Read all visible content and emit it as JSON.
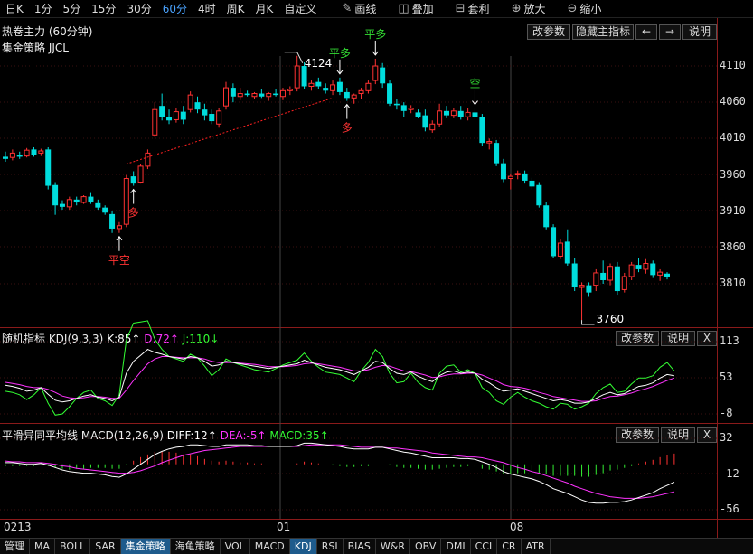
{
  "toolbar": {
    "periods": [
      "日K",
      "1分",
      "5分",
      "15分",
      "30分",
      "60分",
      "4时",
      "周K",
      "月K",
      "自定义"
    ],
    "active_period": "60分",
    "tools": [
      {
        "label": "画线",
        "icon": "pencil-icon"
      },
      {
        "label": "叠加",
        "icon": "stack-icon"
      },
      {
        "label": "套利",
        "icon": "arbitrage-icon"
      },
      {
        "label": "放大",
        "icon": "zoom-in-icon"
      },
      {
        "label": "缩小",
        "icon": "zoom-out-icon"
      }
    ]
  },
  "main": {
    "title": "热卷主力 (60分钟)",
    "strategy": "集金策略 JJCL",
    "buttons": {
      "params": "改参数",
      "hide": "隐藏主指标",
      "prev": "←",
      "next": "→",
      "help": "说明"
    },
    "y_ticks": [
      "4110",
      "4060",
      "4010",
      "3960",
      "3910",
      "3860",
      "3810"
    ],
    "high_label": "4124",
    "low_label": "3760",
    "signals": [
      {
        "text": "平空",
        "color": "#ff3333"
      },
      {
        "text": "多",
        "color": "#ff3333"
      },
      {
        "text": "平多",
        "color": "#33dd33"
      },
      {
        "text": "多",
        "color": "#ff3333"
      },
      {
        "text": "平多",
        "color": "#33dd33"
      },
      {
        "text": "空",
        "color": "#33dd33"
      }
    ]
  },
  "kdj": {
    "title": "随机指标 KDJ(9,3,3)",
    "k_label": "K:85↑",
    "d_label": "D:72↑",
    "j_label": "J:110↓",
    "colors": {
      "k": "#ffffff",
      "d": "#ff33ff",
      "j": "#33ff33"
    },
    "buttons": {
      "params": "改参数",
      "help": "说明",
      "close": "X"
    },
    "y_ticks": [
      "113",
      "53",
      "-8"
    ]
  },
  "macd": {
    "title": "平滑异同平均线 MACD(12,26,9)",
    "diff_label": "DIFF:12↑",
    "dea_label": "DEA:-5↑",
    "macd_label": "MACD:35↑",
    "buttons": {
      "params": "改参数",
      "help": "说明",
      "close": "X"
    },
    "y_ticks": [
      "32",
      "-12",
      "-56"
    ]
  },
  "x_axis": {
    "labels": [
      "0213",
      "01",
      "08"
    ]
  },
  "bottom_tabs": [
    "管理",
    "MA",
    "BOLL",
    "SAR",
    "集金策略",
    "海龟策略",
    "VOL",
    "MACD",
    "KDJ",
    "RSI",
    "BIAS",
    "W&R",
    "OBV",
    "DMI",
    "CCI",
    "CR",
    "ATR"
  ],
  "active_tabs": [
    "集金策略",
    "KDJ"
  ],
  "chart_data": {
    "type": "candlestick",
    "ylim": [
      3760,
      4124
    ],
    "candles": [
      {
        "o": 3985,
        "h": 3992,
        "l": 3978,
        "c": 3982
      },
      {
        "o": 3984,
        "h": 3995,
        "l": 3980,
        "c": 3990
      },
      {
        "o": 3988,
        "h": 3992,
        "l": 3982,
        "c": 3985
      },
      {
        "o": 3986,
        "h": 3997,
        "l": 3984,
        "c": 3994
      },
      {
        "o": 3995,
        "h": 3998,
        "l": 3985,
        "c": 3988
      },
      {
        "o": 3990,
        "h": 3996,
        "l": 3986,
        "c": 3993
      },
      {
        "o": 3995,
        "h": 3998,
        "l": 3940,
        "c": 3945
      },
      {
        "o": 3946,
        "h": 3950,
        "l": 3905,
        "c": 3918
      },
      {
        "o": 3920,
        "h": 3925,
        "l": 3912,
        "c": 3916
      },
      {
        "o": 3916,
        "h": 3930,
        "l": 3912,
        "c": 3926
      },
      {
        "o": 3926,
        "h": 3930,
        "l": 3918,
        "c": 3922
      },
      {
        "o": 3922,
        "h": 3932,
        "l": 3920,
        "c": 3930
      },
      {
        "o": 3930,
        "h": 3935,
        "l": 3920,
        "c": 3922
      },
      {
        "o": 3921,
        "h": 3926,
        "l": 3912,
        "c": 3915
      },
      {
        "o": 3915,
        "h": 3918,
        "l": 3905,
        "c": 3908
      },
      {
        "o": 3906,
        "h": 3910,
        "l": 3880,
        "c": 3886
      },
      {
        "o": 3886,
        "h": 3895,
        "l": 3880,
        "c": 3890
      },
      {
        "o": 3892,
        "h": 3960,
        "l": 3888,
        "c": 3955
      },
      {
        "o": 3958,
        "h": 3965,
        "l": 3945,
        "c": 3948
      },
      {
        "o": 3950,
        "h": 3975,
        "l": 3948,
        "c": 3972
      },
      {
        "o": 3972,
        "h": 3995,
        "l": 3968,
        "c": 3990
      },
      {
        "o": 4015,
        "h": 4060,
        "l": 4012,
        "c": 4050
      },
      {
        "o": 4055,
        "h": 4072,
        "l": 4035,
        "c": 4040
      },
      {
        "o": 4040,
        "h": 4050,
        "l": 4030,
        "c": 4035
      },
      {
        "o": 4036,
        "h": 4052,
        "l": 4032,
        "c": 4047
      },
      {
        "o": 4047,
        "h": 4055,
        "l": 4030,
        "c": 4036
      },
      {
        "o": 4050,
        "h": 4075,
        "l": 4046,
        "c": 4070
      },
      {
        "o": 4060,
        "h": 4068,
        "l": 4045,
        "c": 4050
      },
      {
        "o": 4050,
        "h": 4058,
        "l": 4035,
        "c": 4042
      },
      {
        "o": 4044,
        "h": 4050,
        "l": 4030,
        "c": 4034
      },
      {
        "o": 4030,
        "h": 4052,
        "l": 4025,
        "c": 4048
      },
      {
        "o": 4055,
        "h": 4088,
        "l": 4050,
        "c": 4080
      },
      {
        "o": 4080,
        "h": 4086,
        "l": 4060,
        "c": 4068
      },
      {
        "o": 4068,
        "h": 4080,
        "l": 4063,
        "c": 4072
      },
      {
        "o": 4072,
        "h": 4076,
        "l": 4068,
        "c": 4070
      },
      {
        "o": 4068,
        "h": 4074,
        "l": 4064,
        "c": 4072
      },
      {
        "o": 4072,
        "h": 4078,
        "l": 4066,
        "c": 4068
      },
      {
        "o": 4068,
        "h": 4074,
        "l": 4062,
        "c": 4072
      },
      {
        "o": 4072,
        "h": 4078,
        "l": 4068,
        "c": 4070
      },
      {
        "o": 4068,
        "h": 4080,
        "l": 4063,
        "c": 4076
      },
      {
        "o": 4076,
        "h": 4082,
        "l": 4070,
        "c": 4078
      },
      {
        "o": 4080,
        "h": 4124,
        "l": 4075,
        "c": 4110
      },
      {
        "o": 4110,
        "h": 4115,
        "l": 4078,
        "c": 4082
      },
      {
        "o": 4082,
        "h": 4090,
        "l": 4076,
        "c": 4086
      },
      {
        "o": 4088,
        "h": 4094,
        "l": 4078,
        "c": 4082
      },
      {
        "o": 4080,
        "h": 4086,
        "l": 4072,
        "c": 4076
      },
      {
        "o": 4076,
        "h": 4090,
        "l": 4070,
        "c": 4084
      },
      {
        "o": 4088,
        "h": 4094,
        "l": 4070,
        "c": 4074
      },
      {
        "o": 4074,
        "h": 4080,
        "l": 4062,
        "c": 4066
      },
      {
        "o": 4066,
        "h": 4072,
        "l": 4058,
        "c": 4070
      },
      {
        "o": 4072,
        "h": 4080,
        "l": 4065,
        "c": 4076
      },
      {
        "o": 4076,
        "h": 4090,
        "l": 4072,
        "c": 4086
      },
      {
        "o": 4090,
        "h": 4120,
        "l": 4085,
        "c": 4110
      },
      {
        "o": 4108,
        "h": 4114,
        "l": 4080,
        "c": 4086
      },
      {
        "o": 4086,
        "h": 4090,
        "l": 4055,
        "c": 4058
      },
      {
        "o": 4058,
        "h": 4064,
        "l": 4050,
        "c": 4056
      },
      {
        "o": 4056,
        "h": 4060,
        "l": 4040,
        "c": 4048
      },
      {
        "o": 4050,
        "h": 4056,
        "l": 4045,
        "c": 4052
      },
      {
        "o": 4046,
        "h": 4050,
        "l": 4038,
        "c": 4040
      },
      {
        "o": 4042,
        "h": 4050,
        "l": 4020,
        "c": 4025
      },
      {
        "o": 4022,
        "h": 4035,
        "l": 4018,
        "c": 4030
      },
      {
        "o": 4030,
        "h": 4058,
        "l": 4026,
        "c": 4048
      },
      {
        "o": 4048,
        "h": 4055,
        "l": 4038,
        "c": 4042
      },
      {
        "o": 4042,
        "h": 4052,
        "l": 4038,
        "c": 4048
      },
      {
        "o": 4048,
        "h": 4055,
        "l": 4036,
        "c": 4040
      },
      {
        "o": 4040,
        "h": 4052,
        "l": 4035,
        "c": 4046
      },
      {
        "o": 4046,
        "h": 4052,
        "l": 4036,
        "c": 4040
      },
      {
        "o": 4040,
        "h": 4044,
        "l": 4000,
        "c": 4004
      },
      {
        "o": 4004,
        "h": 4010,
        "l": 3995,
        "c": 4006
      },
      {
        "o": 4004,
        "h": 4008,
        "l": 3972,
        "c": 3976
      },
      {
        "o": 3976,
        "h": 3982,
        "l": 3950,
        "c": 3954
      },
      {
        "o": 3955,
        "h": 3962,
        "l": 3940,
        "c": 3958
      },
      {
        "o": 3960,
        "h": 3966,
        "l": 3954,
        "c": 3962
      },
      {
        "o": 3962,
        "h": 3966,
        "l": 3948,
        "c": 3952
      },
      {
        "o": 3952,
        "h": 3956,
        "l": 3940,
        "c": 3944
      },
      {
        "o": 3946,
        "h": 3950,
        "l": 3915,
        "c": 3918
      },
      {
        "o": 3918,
        "h": 3922,
        "l": 3885,
        "c": 3888
      },
      {
        "o": 3888,
        "h": 3892,
        "l": 3845,
        "c": 3848
      },
      {
        "o": 3848,
        "h": 3872,
        "l": 3844,
        "c": 3866
      },
      {
        "o": 3868,
        "h": 3885,
        "l": 3835,
        "c": 3838
      },
      {
        "o": 3838,
        "h": 3845,
        "l": 3800,
        "c": 3805
      },
      {
        "o": 3805,
        "h": 3812,
        "l": 3760,
        "c": 3808
      },
      {
        "o": 3808,
        "h": 3812,
        "l": 3792,
        "c": 3798
      },
      {
        "o": 3808,
        "h": 3830,
        "l": 3800,
        "c": 3825
      },
      {
        "o": 3825,
        "h": 3842,
        "l": 3810,
        "c": 3815
      },
      {
        "o": 3815,
        "h": 3838,
        "l": 3808,
        "c": 3834
      },
      {
        "o": 3834,
        "h": 3840,
        "l": 3795,
        "c": 3800
      },
      {
        "o": 3802,
        "h": 3825,
        "l": 3798,
        "c": 3820
      },
      {
        "o": 3820,
        "h": 3840,
        "l": 3815,
        "c": 3836
      },
      {
        "o": 3836,
        "h": 3845,
        "l": 3826,
        "c": 3830
      },
      {
        "o": 3830,
        "h": 3844,
        "l": 3824,
        "c": 3838
      },
      {
        "o": 3838,
        "h": 3842,
        "l": 3818,
        "c": 3822
      },
      {
        "o": 3822,
        "h": 3830,
        "l": 3814,
        "c": 3826
      },
      {
        "o": 3824,
        "h": 3826,
        "l": 3816,
        "c": 3820
      }
    ],
    "kdj_k": [
      40,
      38,
      35,
      30,
      32,
      36,
      25,
      15,
      12,
      14,
      18,
      22,
      24,
      20,
      18,
      14,
      20,
      60,
      80,
      90,
      100,
      95,
      92,
      88,
      86,
      84,
      88,
      86,
      80,
      72,
      74,
      80,
      78,
      76,
      74,
      72,
      70,
      68,
      70,
      72,
      74,
      76,
      82,
      78,
      74,
      70,
      68,
      66,
      62,
      58,
      64,
      70,
      80,
      78,
      68,
      60,
      58,
      62,
      55,
      50,
      46,
      56,
      62,
      64,
      60,
      62,
      60,
      50,
      44,
      36,
      30,
      32,
      34,
      30,
      26,
      22,
      18,
      14,
      16,
      14,
      10,
      10,
      12,
      18,
      24,
      28,
      24,
      26,
      32,
      38,
      40,
      44,
      52,
      58,
      56
    ],
    "kdj_d": [
      45,
      43,
      41,
      38,
      36,
      36,
      33,
      28,
      22,
      19,
      18,
      19,
      21,
      21,
      20,
      18,
      18,
      32,
      48,
      62,
      76,
      84,
      88,
      88,
      87,
      86,
      86,
      86,
      84,
      80,
      78,
      78,
      78,
      77,
      76,
      75,
      73,
      71,
      71,
      71,
      72,
      73,
      76,
      77,
      76,
      74,
      72,
      70,
      67,
      64,
      64,
      66,
      70,
      73,
      72,
      68,
      64,
      63,
      60,
      57,
      53,
      54,
      57,
      59,
      59,
      60,
      60,
      57,
      52,
      47,
      41,
      38,
      37,
      35,
      32,
      28,
      25,
      21,
      19,
      17,
      15,
      13,
      13,
      14,
      18,
      21,
      22,
      24,
      27,
      31,
      34,
      38,
      43,
      48,
      52
    ],
    "kdj_j": [
      30,
      28,
      24,
      16,
      24,
      36,
      10,
      -10,
      -8,
      4,
      18,
      28,
      32,
      18,
      14,
      6,
      24,
      116,
      144,
      146,
      148,
      117,
      100,
      88,
      84,
      80,
      92,
      86,
      72,
      56,
      66,
      84,
      78,
      74,
      70,
      66,
      64,
      62,
      68,
      74,
      78,
      82,
      94,
      80,
      70,
      62,
      60,
      58,
      52,
      46,
      64,
      78,
      100,
      88,
      60,
      44,
      46,
      60,
      45,
      36,
      32,
      60,
      72,
      74,
      62,
      66,
      60,
      36,
      28,
      14,
      8,
      20,
      28,
      20,
      14,
      10,
      4,
      0,
      10,
      8,
      0,
      4,
      10,
      26,
      36,
      42,
      28,
      30,
      42,
      52,
      52,
      56,
      70,
      78,
      64
    ],
    "macd_diff": [
      2,
      2,
      1,
      0,
      0,
      1,
      -1,
      -4,
      -7,
      -9,
      -10,
      -11,
      -11,
      -12,
      -13,
      -15,
      -16,
      -12,
      -6,
      0,
      6,
      12,
      16,
      19,
      21,
      22,
      24,
      24,
      23,
      22,
      22,
      24,
      24,
      24,
      24,
      23,
      23,
      22,
      22,
      22,
      22,
      23,
      26,
      26,
      25,
      24,
      23,
      22,
      20,
      19,
      19,
      19,
      21,
      21,
      19,
      17,
      15,
      14,
      12,
      10,
      8,
      8,
      8,
      8,
      7,
      7,
      6,
      3,
      0,
      -4,
      -9,
      -12,
      -14,
      -16,
      -18,
      -21,
      -25,
      -30,
      -33,
      -36,
      -40,
      -44,
      -47,
      -48,
      -48,
      -47,
      -47,
      -46,
      -44,
      -41,
      -38,
      -35,
      -30,
      -26,
      -22
    ],
    "macd_dea": [
      4,
      3,
      3,
      2,
      2,
      2,
      1,
      0,
      -2,
      -3,
      -5,
      -6,
      -7,
      -8,
      -9,
      -10,
      -11,
      -11,
      -10,
      -8,
      -5,
      -2,
      2,
      5,
      8,
      11,
      13,
      15,
      17,
      18,
      19,
      20,
      21,
      22,
      22,
      22,
      22,
      22,
      22,
      22,
      22,
      22,
      23,
      24,
      24,
      24,
      24,
      24,
      23,
      22,
      21,
      21,
      21,
      21,
      20,
      20,
      19,
      18,
      17,
      16,
      14,
      13,
      12,
      11,
      10,
      9,
      9,
      8,
      6,
      4,
      2,
      -1,
      -4,
      -6,
      -9,
      -11,
      -14,
      -17,
      -20,
      -23,
      -27,
      -30,
      -33,
      -36,
      -38,
      -40,
      -41,
      -42,
      -42,
      -42,
      -41,
      -40,
      -38,
      -36,
      -34
    ],
    "macd_bar": [
      -4,
      -4,
      -4,
      -4,
      -4,
      -2,
      -4,
      -8,
      -10,
      -12,
      -10,
      -10,
      -8,
      -8,
      -8,
      -10,
      -10,
      -2,
      8,
      16,
      22,
      28,
      28,
      28,
      26,
      22,
      22,
      18,
      12,
      8,
      6,
      8,
      6,
      4,
      4,
      2,
      2,
      0,
      0,
      0,
      0,
      2,
      6,
      4,
      2,
      0,
      -2,
      -4,
      -6,
      -6,
      -4,
      -4,
      0,
      0,
      -2,
      -6,
      -8,
      -8,
      -10,
      -12,
      -12,
      -10,
      -8,
      -6,
      -6,
      -4,
      -6,
      -10,
      -12,
      -16,
      -22,
      -22,
      -20,
      -20,
      -18,
      -20,
      -22,
      -26,
      -26,
      -26,
      -26,
      -28,
      -28,
      -24,
      -20,
      -14,
      -12,
      -8,
      -4,
      2,
      6,
      10,
      16,
      20,
      24
    ]
  }
}
